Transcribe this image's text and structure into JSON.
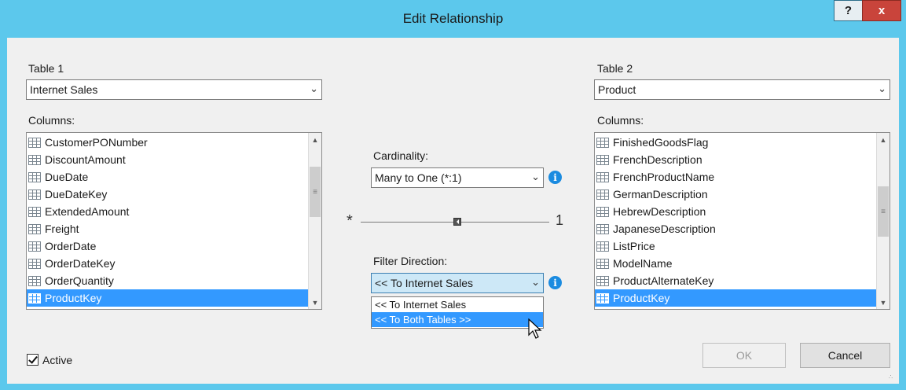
{
  "window": {
    "title": "Edit Relationship",
    "help_label": "?",
    "close_label": "x",
    "titlebar_color": "#5cc8ec"
  },
  "table1": {
    "label": "Table 1",
    "selected": "Internet Sales",
    "columns_label": "Columns:",
    "columns": [
      "CustomerPONumber",
      "DiscountAmount",
      "DueDate",
      "DueDateKey",
      "ExtendedAmount",
      "Freight",
      "OrderDate",
      "OrderDateKey",
      "OrderQuantity",
      "ProductKey"
    ],
    "selected_column": "ProductKey"
  },
  "table2": {
    "label": "Table 2",
    "selected": "Product",
    "columns_label": "Columns:",
    "columns": [
      "FinishedGoodsFlag",
      "FrenchDescription",
      "FrenchProductName",
      "GermanDescription",
      "HebrewDescription",
      "JapaneseDescription",
      "ListPrice",
      "ModelName",
      "ProductAlternateKey",
      "ProductKey"
    ],
    "selected_column": "ProductKey"
  },
  "cardinality": {
    "label": "Cardinality:",
    "selected": "Many to One (*:1)",
    "left_symbol": "*",
    "right_symbol": "1"
  },
  "filter": {
    "label": "Filter Direction:",
    "selected": "<< To Internet Sales",
    "options": [
      "<< To Internet Sales",
      "<< To Both Tables >>"
    ],
    "highlighted_option": "<< To Both Tables >>"
  },
  "active": {
    "label": "Active",
    "checked": true
  },
  "buttons": {
    "ok": "OK",
    "cancel": "Cancel"
  },
  "colors": {
    "selection": "#3399ff",
    "info": "#1a8be0",
    "close": "#c9443b"
  }
}
